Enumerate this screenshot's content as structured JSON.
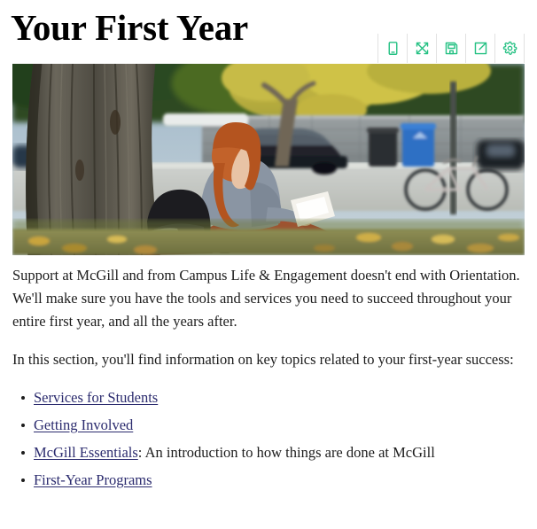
{
  "header": {
    "title": "Your First Year"
  },
  "toolbar": {
    "buttons": [
      {
        "name": "mobile-preview",
        "icon": "mobile-icon",
        "label": "Mobile preview"
      },
      {
        "name": "fullscreen",
        "icon": "expand-arrows-icon",
        "label": "Fullscreen"
      },
      {
        "name": "save",
        "icon": "floppy-disk-icon",
        "label": "Save"
      },
      {
        "name": "share",
        "icon": "share-export-icon",
        "label": "Share"
      },
      {
        "name": "settings",
        "icon": "gear-icon",
        "label": "Settings"
      }
    ],
    "icon_color": "#25c183",
    "divider_color": "#e2e2e2"
  },
  "hero": {
    "alt": "Student with red hair sitting against a large tree reading papers on an autumn campus lawn, with a parked car, stone wall, blue recycling bin and a bicycle in the background."
  },
  "main": {
    "paragraphs": [
      "Support at McGill and from Campus Life & Engagement doesn't end with Orientation. We'll make sure you have the tools and services you need to succeed throughout your entire first year, and all the years after.",
      "In this section, you'll find information on key topics related to your first-year success:"
    ],
    "list": [
      {
        "link": "Services for Students",
        "rest": ""
      },
      {
        "link": "Getting Involved",
        "rest": ""
      },
      {
        "link": "McGill Essentials",
        "rest": ": An introduction to how things are done at McGill"
      },
      {
        "link": "First-Year Programs",
        "rest": ""
      }
    ],
    "link_color": "#2b2b6e",
    "text_color": "#1c1c1c"
  }
}
